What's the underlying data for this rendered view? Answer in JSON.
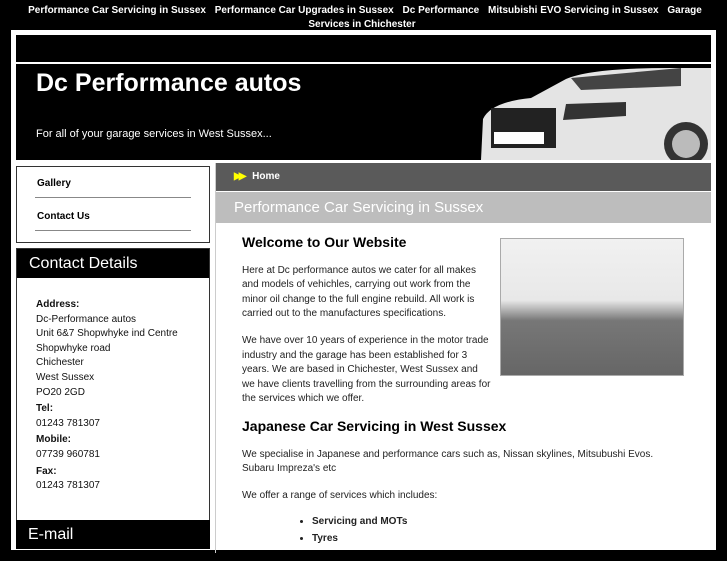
{
  "topnav": [
    "Performance Car Servicing in Sussex",
    "Performance Car Upgrades in Sussex",
    "Dc Performance",
    "Mitsubishi EVO Servicing in Sussex",
    "Garage Services in Chichester"
  ],
  "header": {
    "title": "Dc Performance autos",
    "tagline": "For all of your garage services in West Sussex..."
  },
  "sidebar": {
    "nav": [
      "Gallery",
      "Contact Us"
    ],
    "contact_title": "Contact Details",
    "address_label": "Address:",
    "address": [
      "Dc-Performance autos",
      "Unit 6&7 Shopwhyke ind Centre",
      "Shopwhyke road",
      "Chichester",
      "West Sussex",
      "PO20 2GD"
    ],
    "tel_label": "Tel:",
    "tel": "01243 781307",
    "mobile_label": "Mobile:",
    "mobile": "07739 960781",
    "fax_label": "Fax:",
    "fax": "01243 781307",
    "email_title": "E-mail"
  },
  "main": {
    "breadcrumb": "Home",
    "page_title": "Performance Car Servicing in Sussex",
    "h1": "Welcome to Our Website",
    "p1": "Here at Dc performance autos we cater for all makes and models of vehichles, carrying out work from the minor oil change to the full engine rebuild. All work is carried out to the manufactures specifications.",
    "p2": "We have over 10 years of experience in the motor trade industry and the garage has been established for 3 years. We are based in Chichester, West Sussex and we have clients travelling from the surrounding areas for the services which we offer.",
    "h2": "Japanese Car Servicing in West Sussex",
    "p3": "We specialise in Japanese and performance cars such as, Nissan skylines, Mitsubushi Evos. Subaru Impreza's etc",
    "p4": "We offer a range of services which includes:",
    "services": [
      "Servicing and MOTs",
      "Tyres"
    ]
  }
}
